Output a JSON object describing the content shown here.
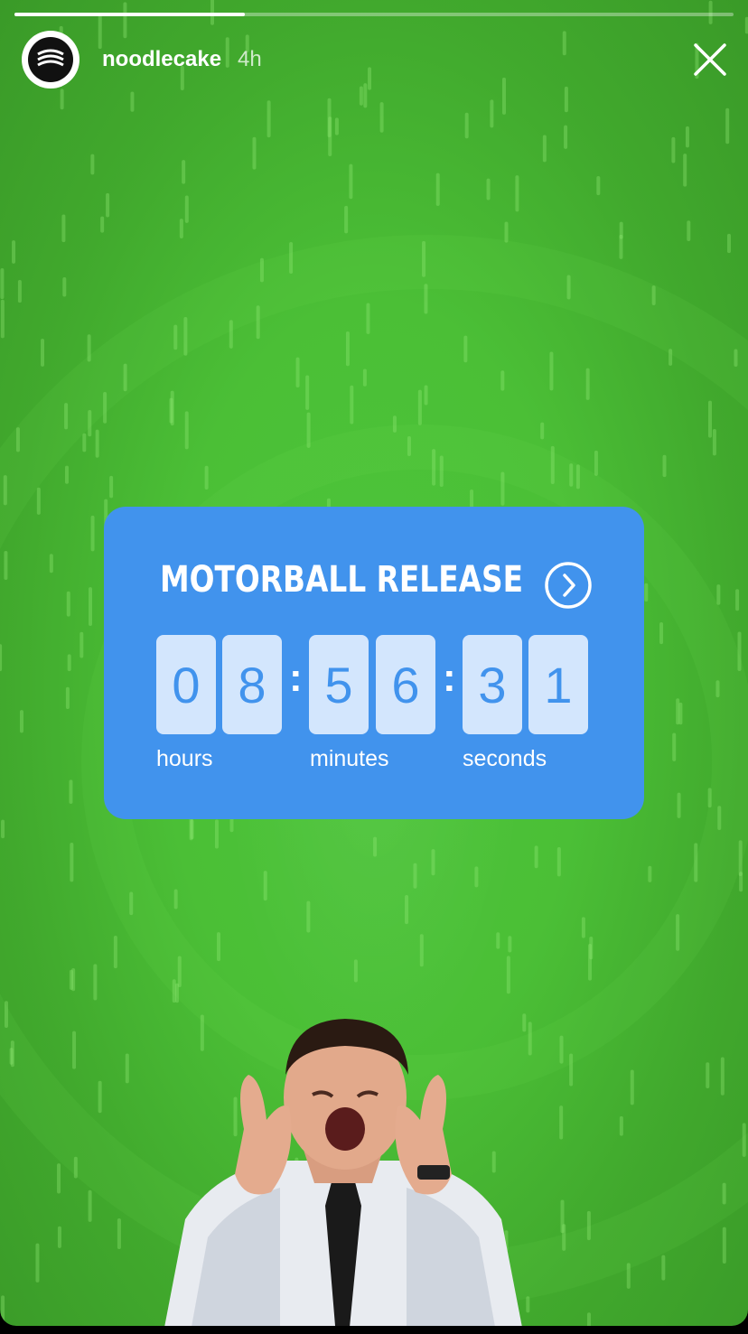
{
  "story": {
    "username": "noodlecake",
    "age": "4h",
    "progress": 0.32
  },
  "icons": {
    "avatar": "noodlecake-logo-icon",
    "close": "close-icon",
    "sticker_link": "chevron-right-circle-icon"
  },
  "countdown": {
    "title": "MOTORBALL RELEASE",
    "hours": [
      "0",
      "8"
    ],
    "minutes": [
      "5",
      "6"
    ],
    "seconds": [
      "3",
      "1"
    ],
    "separator": ":",
    "labels": {
      "hours": "hours",
      "minutes": "minutes",
      "seconds": "seconds"
    }
  },
  "colors": {
    "background": "#4bbf36",
    "sticker": "#4193ed",
    "digit_bg": "#d3e6fd"
  }
}
